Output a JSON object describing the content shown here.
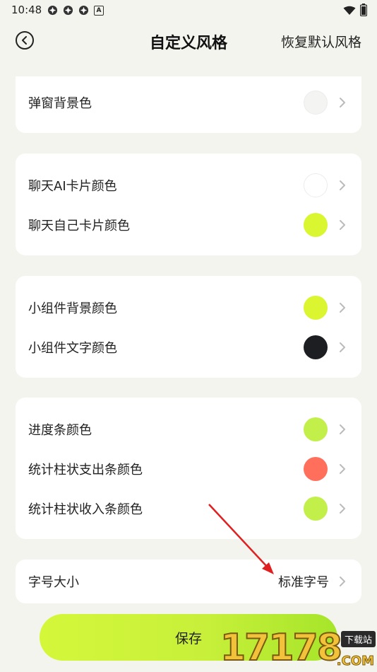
{
  "status_bar": {
    "time": "10:48",
    "badge_letter": "A"
  },
  "header": {
    "title": "自定义风格",
    "reset_label": "恢复默认风格"
  },
  "groups": [
    {
      "rows": [
        {
          "label": "弹窗背景色",
          "swatch_color": "#f4f4f2"
        }
      ]
    },
    {
      "rows": [
        {
          "label": "聊天AI卡片颜色",
          "swatch_color": "#ffffff"
        },
        {
          "label": "聊天自己卡片颜色",
          "swatch_color": "#d9f631"
        }
      ]
    },
    {
      "rows": [
        {
          "label": "小组件背景颜色",
          "swatch_color": "#dbf631"
        },
        {
          "label": "小组件文字颜色",
          "swatch_color": "#1c1e22"
        }
      ]
    },
    {
      "rows": [
        {
          "label": "进度条颜色",
          "swatch_color": "#c2ef4a"
        },
        {
          "label": "统计柱状支出条颜色",
          "swatch_color": "#ff6f5c"
        },
        {
          "label": "统计柱状收入条颜色",
          "swatch_color": "#c2ef4a"
        }
      ]
    },
    {
      "rows": [
        {
          "label": "字号大小",
          "value": "标准字号"
        }
      ]
    }
  ],
  "save_button": {
    "label": "保存"
  },
  "watermark": {
    "digits": "17178",
    "tag": "下载站",
    "suffix": ".COM"
  },
  "colors": {
    "background": "#f4f4ef",
    "card": "#ffffff",
    "accent": "#d4f73a",
    "annotation_arrow": "#e02020"
  }
}
